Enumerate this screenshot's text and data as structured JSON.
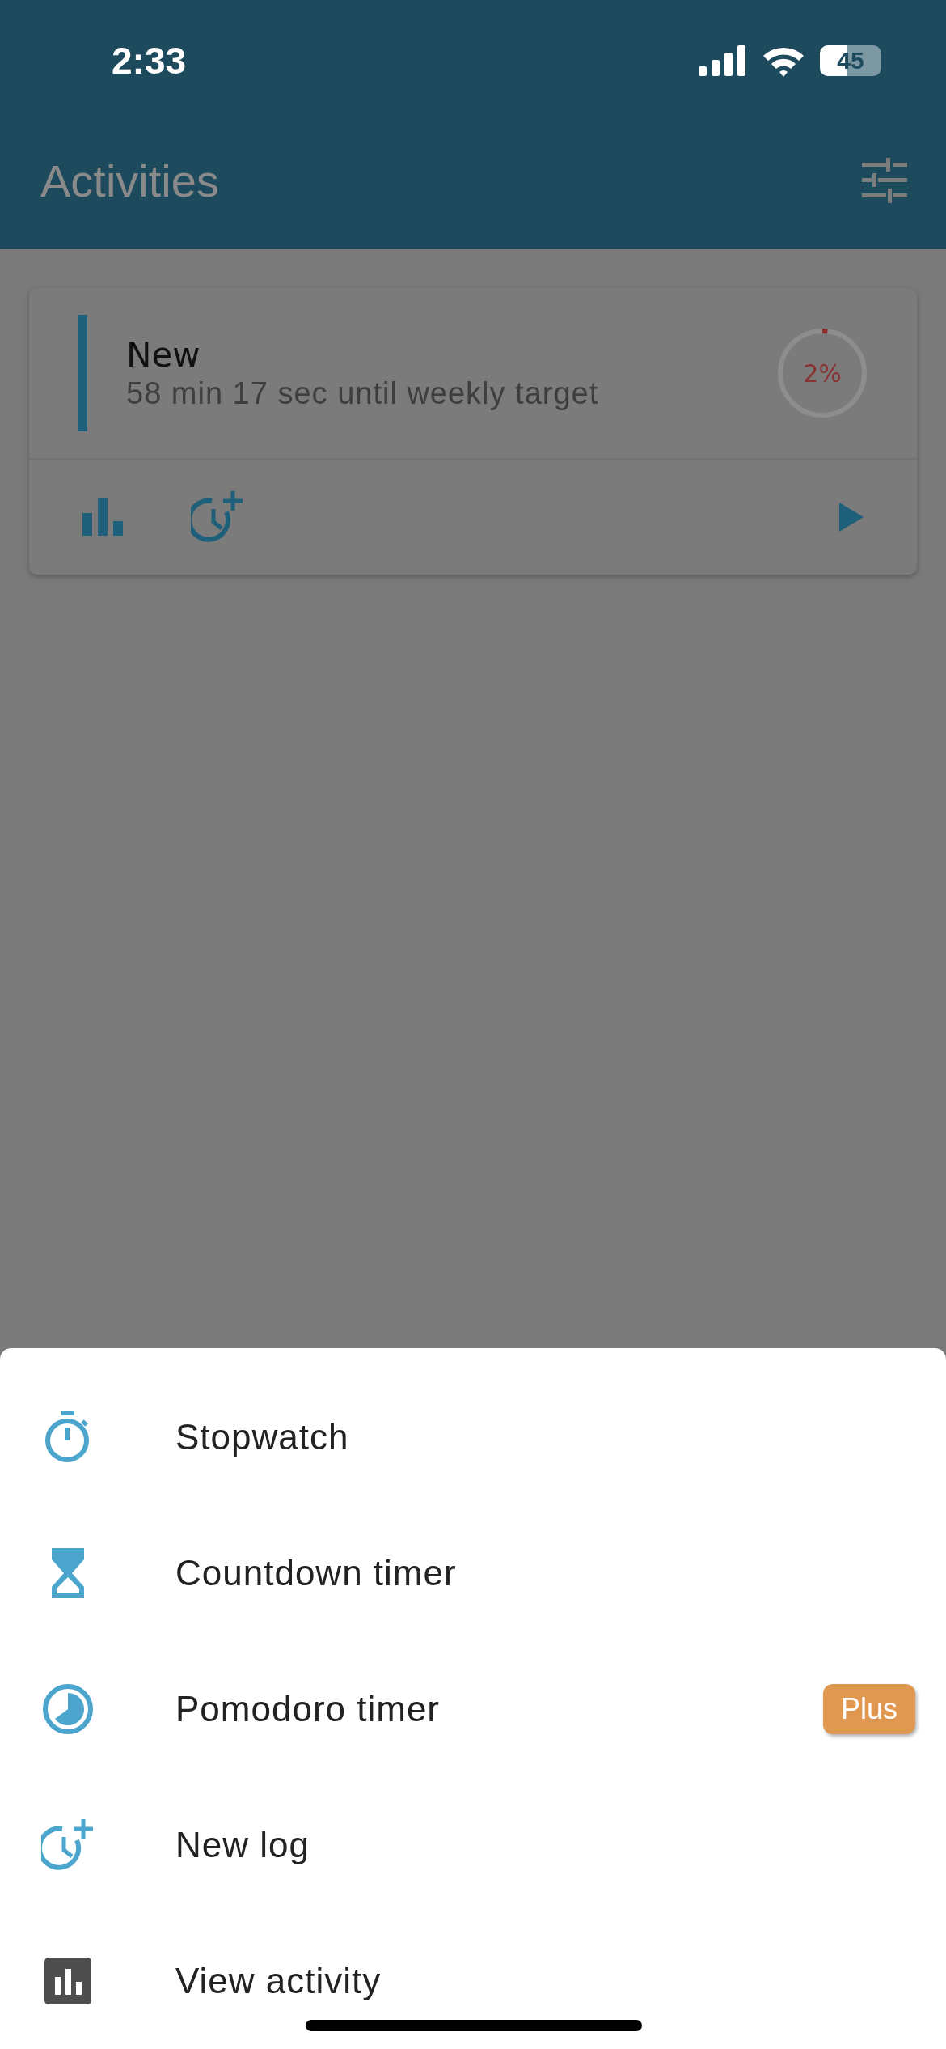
{
  "status_bar": {
    "time": "2:33",
    "battery": {
      "text": "45",
      "level": 0.45
    }
  },
  "header": {
    "title": "Activities"
  },
  "activity": {
    "name": "New",
    "subtitle": "58 min 17 sec until weekly target",
    "progress": {
      "level": 0.02,
      "text": "2%"
    }
  },
  "menu": [
    {
      "kind": "stopwatch",
      "label": "Stopwatch"
    },
    {
      "kind": "hourglass",
      "label": "Countdown timer"
    },
    {
      "kind": "pomodoro",
      "label": "Pomodoro timer",
      "badge": "Plus"
    },
    {
      "kind": "newlog",
      "label": "New log"
    },
    {
      "kind": "chart",
      "label": "View activity"
    }
  ]
}
